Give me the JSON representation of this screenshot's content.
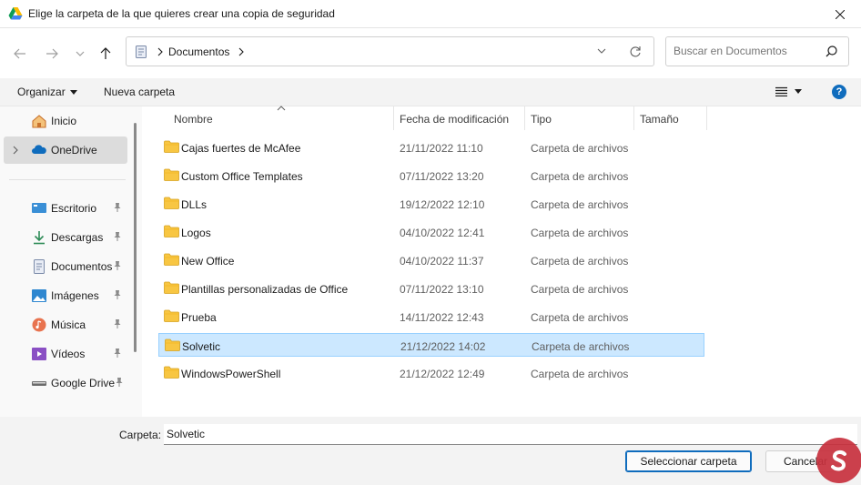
{
  "window": {
    "title": "Elige la carpeta de la que quieres crear una copia de seguridad"
  },
  "address": {
    "crumb": "Documentos"
  },
  "search": {
    "placeholder": "Buscar en Documentos"
  },
  "toolbar": {
    "organize": "Organizar",
    "new_folder": "Nueva carpeta",
    "help": "?"
  },
  "sidebar": {
    "items": [
      {
        "label": "Inicio",
        "icon": "home-icon"
      },
      {
        "label": "OneDrive",
        "icon": "cloud-icon"
      },
      {
        "label": "Escritorio",
        "icon": "desktop-icon"
      },
      {
        "label": "Descargas",
        "icon": "download-icon"
      },
      {
        "label": "Documentos",
        "icon": "document-icon"
      },
      {
        "label": "Imágenes",
        "icon": "image-icon"
      },
      {
        "label": "Música",
        "icon": "music-icon"
      },
      {
        "label": "Vídeos",
        "icon": "video-icon"
      },
      {
        "label": "Google Drive",
        "icon": "drive-icon"
      }
    ]
  },
  "columns": {
    "name": "Nombre",
    "date": "Fecha de modificación",
    "type": "Tipo",
    "size": "Tamaño"
  },
  "files": [
    {
      "name": "Cajas fuertes de McAfee",
      "date": "21/11/2022 11:10",
      "type": "Carpeta de archivos"
    },
    {
      "name": "Custom Office Templates",
      "date": "07/11/2022 13:20",
      "type": "Carpeta de archivos"
    },
    {
      "name": "DLLs",
      "date": "19/12/2022 12:10",
      "type": "Carpeta de archivos"
    },
    {
      "name": "Logos",
      "date": "04/10/2022 12:41",
      "type": "Carpeta de archivos"
    },
    {
      "name": "New Office",
      "date": "04/10/2022 11:37",
      "type": "Carpeta de archivos"
    },
    {
      "name": "Plantillas personalizadas de Office",
      "date": "07/11/2022 13:10",
      "type": "Carpeta de archivos"
    },
    {
      "name": "Prueba",
      "date": "14/11/2022 12:43",
      "type": "Carpeta de archivos"
    },
    {
      "name": "Solvetic",
      "date": "21/12/2022 14:02",
      "type": "Carpeta de archivos"
    },
    {
      "name": "WindowsPowerShell",
      "date": "21/12/2022 12:49",
      "type": "Carpeta de archivos"
    }
  ],
  "footer": {
    "folder_label": "Carpeta:",
    "folder_value": "Solvetic",
    "select_button": "Seleccionar carpeta",
    "cancel_button": "Cancelar"
  },
  "colors": {
    "accent": "#0f6cbd",
    "selection": "#cce8ff",
    "folder": "#f8c642"
  }
}
